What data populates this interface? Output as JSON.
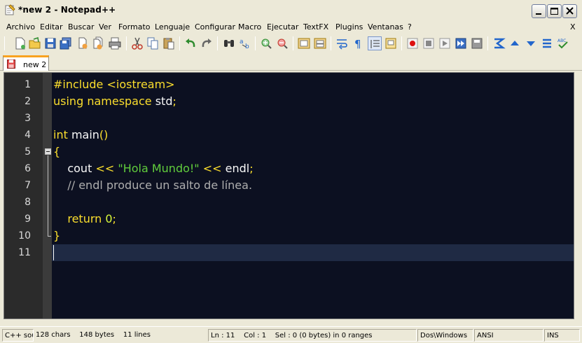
{
  "window": {
    "title": "*new  2 - Notepad++",
    "accent": "#f9a21f"
  },
  "menu": {
    "items": [
      "Archivo",
      "Editar",
      "Buscar",
      "Ver",
      "Formato",
      "Lenguaje",
      "Configurar",
      "Macro",
      "Ejecutar",
      "TextFX",
      "Plugins",
      "Ventanas",
      "?"
    ],
    "close_doc": "X"
  },
  "toolbar": {
    "icons": [
      "new-file-icon",
      "open-file-icon",
      "save-icon",
      "save-all-icon",
      "close-icon",
      "close-all-icon",
      "print-icon",
      "cut-icon",
      "copy-icon",
      "paste-icon",
      "undo-icon",
      "redo-icon",
      "find-icon",
      "replace-icon",
      "zoom-in-icon",
      "zoom-out-icon",
      "sync-vertical-icon",
      "sync-horizontal-icon",
      "word-wrap-icon",
      "show-all-chars-icon",
      "indent-guide-icon",
      "document-map-icon",
      "record-macro-icon",
      "stop-macro-icon",
      "play-macro-icon",
      "run-macro-multiple-icon",
      "save-macro-icon",
      "trim-icon",
      "move-up-icon",
      "move-down-icon",
      "clear-icon",
      "spell-check-icon"
    ]
  },
  "tabs": [
    {
      "label": "new  2",
      "icon": "unsaved-file-icon"
    }
  ],
  "editor": {
    "line_numbers": [
      "1",
      "2",
      "3",
      "4",
      "5",
      "6",
      "7",
      "8",
      "9",
      "10",
      "11"
    ],
    "lines": [
      [
        {
          "t": "#include <iostream>",
          "c": "pre"
        }
      ],
      [
        {
          "t": "using",
          "c": "kw"
        },
        {
          "t": " ",
          "c": ""
        },
        {
          "t": "namespace",
          "c": "kw"
        },
        {
          "t": " std",
          "c": ""
        },
        {
          "t": ";",
          "c": "kw"
        }
      ],
      [],
      [
        {
          "t": "int",
          "c": "kw"
        },
        {
          "t": " main",
          "c": ""
        },
        {
          "t": "()",
          "c": "kw"
        }
      ],
      [
        {
          "t": "{",
          "c": "kw"
        }
      ],
      [
        {
          "t": "    cout ",
          "c": ""
        },
        {
          "t": "<<",
          "c": "kw"
        },
        {
          "t": " ",
          "c": ""
        },
        {
          "t": "\"Hola Mundo!\"",
          "c": "str"
        },
        {
          "t": " ",
          "c": ""
        },
        {
          "t": "<<",
          "c": "kw"
        },
        {
          "t": " endl",
          "c": ""
        },
        {
          "t": ";",
          "c": "kw"
        }
      ],
      [
        {
          "t": "    // endl produce un salto de línea.",
          "c": "cmt"
        }
      ],
      [],
      [
        {
          "t": "    ",
          "c": ""
        },
        {
          "t": "return",
          "c": "kw"
        },
        {
          "t": " ",
          "c": ""
        },
        {
          "t": "0",
          "c": "num"
        },
        {
          "t": ";",
          "c": "kw"
        }
      ],
      [
        {
          "t": "}",
          "c": "kw"
        }
      ],
      []
    ],
    "current_line": 11
  },
  "status": {
    "language": "C++ source file",
    "chars": "128 chars",
    "bytes": "148 bytes",
    "lines": "11 lines",
    "ln": "Ln : 11",
    "col": "Col : 1",
    "sel": "Sel : 0 (0 bytes) in 0 ranges",
    "eol": "Dos\\Windows",
    "encoding": "ANSI",
    "mode": "INS"
  }
}
